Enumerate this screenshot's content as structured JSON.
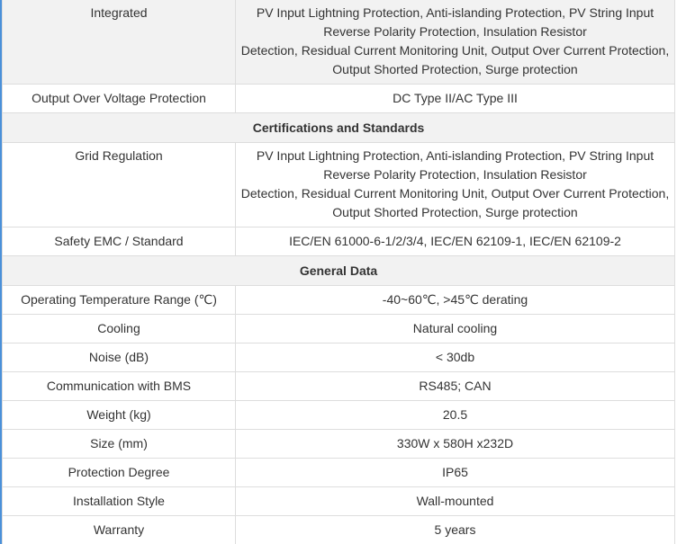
{
  "protection_rows": [
    {
      "label": "Integrated",
      "lines": [
        "PV Input Lightning Protection, Anti-islanding Protection, PV String Input",
        "Reverse Polarity Protection, Insulation Resistor",
        "Detection, Residual Current Monitoring Unit, Output Over Current Protection,",
        "Output Shorted Protection, Surge protection"
      ]
    },
    {
      "label": "Output Over Voltage Protection",
      "value": "DC Type II/AC Type III"
    }
  ],
  "certifications": {
    "heading": "Certifications and Standards",
    "grid_regulation": {
      "label": "Grid Regulation",
      "lines": [
        "PV Input Lightning Protection, Anti-islanding Protection, PV String Input",
        "Reverse Polarity Protection, Insulation Resistor",
        "Detection, Residual Current Monitoring Unit, Output Over Current Protection,",
        "Output Shorted Protection, Surge protection"
      ]
    },
    "safety": {
      "label": "Safety EMC / Standard",
      "value": "IEC/EN 61000-6-1/2/3/4, IEC/EN 62109-1, IEC/EN 62109-2"
    }
  },
  "general": {
    "heading": "General Data",
    "rows": [
      {
        "label": "Operating Temperature Range (℃)",
        "value": "-40~60℃, >45℃ derating"
      },
      {
        "label": "Cooling",
        "value": "Natural cooling"
      },
      {
        "label": "Noise (dB)",
        "value": "< 30db"
      },
      {
        "label": "Communication with BMS",
        "value": "RS485; CAN"
      },
      {
        "label": "Weight (kg)",
        "value": "20.5"
      },
      {
        "label": "Size (mm)",
        "value": "330W x 580H x232D"
      },
      {
        "label": "Protection Degree",
        "value": "IP65"
      },
      {
        "label": "Installation Style",
        "value": "Wall-mounted"
      },
      {
        "label": "Warranty",
        "value": "5 years"
      }
    ]
  },
  "colors": {
    "accent_left_rule": "#4a90d9",
    "border": "#dddddd",
    "alt_row": "#f2f2f2",
    "text": "#333333"
  }
}
